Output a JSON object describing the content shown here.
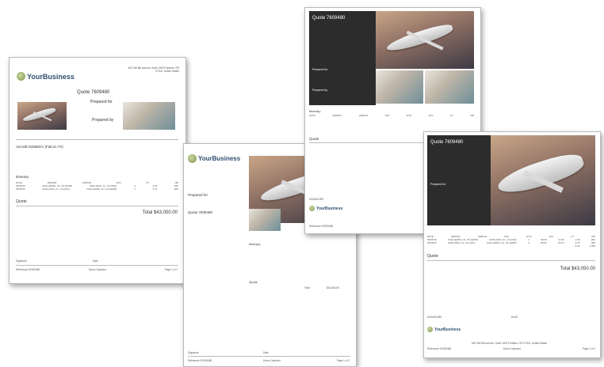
{
  "brand": {
    "name": "YourBusiness",
    "tagline": "your slogan here"
  },
  "quote": {
    "title": "Quote 7609480",
    "title_short": "Quote 7609480",
    "prepared_for_label": "Prepared for",
    "prepared_by_label": "Prepared by",
    "aircraft_label": "Aircraft N1568GV (Falcon 7X)",
    "itinerary_label": "Itinerary",
    "quote_label": "Quote",
    "total": "Total $43,050.00",
    "total_label": "Total:",
    "total_value": "$43,050.00",
    "signature_label": "Signature",
    "date_label": "Date",
    "signature_caps": "SIGNATURE",
    "date_caps": "DATE",
    "page_label": "Page 1 of 2",
    "reference": "Reference N7609480",
    "company": "Demo Operator",
    "address": "500 SW 8th Avenue, Suite 1900 Portland, OR 97204, United States"
  },
  "itinerary_headers": [
    "DATE",
    "DEPART",
    "ARRIVE",
    "PAX",
    "ETD",
    "ETA",
    "FT",
    "NM"
  ],
  "itinerary_rows": [
    [
      "05/05/15",
      "KIAD (EWR), NJ, US (EWR)",
      "KMIA (MIA), FL, US (MIA)",
      "4",
      "08:00",
      "11:45",
      "2.45",
      "994"
    ],
    [
      "05/05/15",
      "KMIA (MIA), FL, US (MIA)",
      "KIAD (EWR), NJ, US (EWR)",
      "4",
      "06:00",
      "10:15",
      "2.75",
      "984"
    ]
  ],
  "itinerary_totals": [
    "5.20",
    "1,098"
  ]
}
